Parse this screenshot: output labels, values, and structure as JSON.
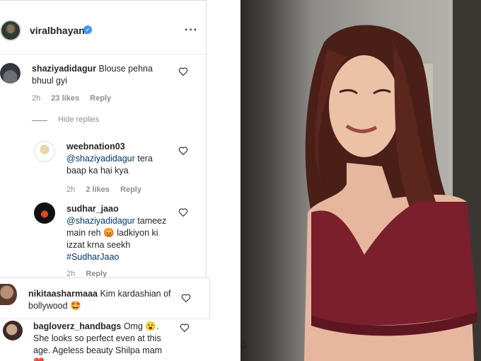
{
  "header": {
    "username": "viralbhayani",
    "more_icon": "more-horizontal-icon"
  },
  "comment": {
    "username": "shaziyadidagur",
    "text": "Blouse pehna bhuul gyi",
    "time": "2h",
    "likes": "23 likes",
    "reply": "Reply"
  },
  "hide_replies": "Hide replies",
  "replies": [
    {
      "username": "weebnation03",
      "mention": "@shaziyadidagur",
      "text": "tera baap ka hai kya",
      "time": "2h",
      "likes": "2 likes",
      "reply": "Reply"
    },
    {
      "username": "sudhar_jaao",
      "mention": "@shaziyadidagur",
      "text_a": "tameez main reh",
      "emoji": "😡",
      "text_b": "ladkiyon ki izzat krna seekh",
      "hashtag": "#SudharJaao",
      "time": "2h",
      "reply": "Reply"
    }
  ],
  "overlay_comments": [
    {
      "username": "nikitaasharmaaa",
      "text": "Kim kardashian of bollywood",
      "emoji": "🤩"
    },
    {
      "username": "bagloverz_handbags",
      "text_a": "Omg",
      "emoji": "😮",
      "text_b": ". She looks so perfect even at this age. Ageless beauty Shilpa mam",
      "emoji2": "❤️"
    }
  ],
  "watermark": "b",
  "colors": {
    "link": "#00376b",
    "muted": "#8e8e8e",
    "verified": "#3897f0",
    "top_dress": "#7a1f2b"
  }
}
